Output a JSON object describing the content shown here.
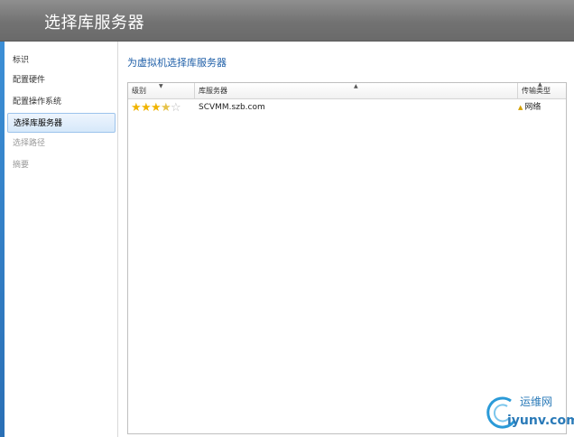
{
  "window": {
    "title": "选择库服务器"
  },
  "sidebar": {
    "items": [
      {
        "label": "标识",
        "state": "normal"
      },
      {
        "label": "配置硬件",
        "state": "normal"
      },
      {
        "label": "配置操作系统",
        "state": "normal"
      },
      {
        "label": "选择库服务器",
        "state": "active"
      },
      {
        "label": "选择路径",
        "state": "disabled"
      },
      {
        "label": "摘要",
        "state": "disabled"
      }
    ]
  },
  "main": {
    "title": "为虚拟机选择库服务器",
    "table": {
      "columns": [
        "级别",
        "库服务器",
        "传输类型"
      ],
      "rows": [
        {
          "rating": 3.5,
          "rating_max": 5,
          "server": "SCVMM.szb.com",
          "transfer": "网络"
        }
      ]
    }
  },
  "watermark": {
    "text1": "运维网",
    "text2": "iyunv.com"
  },
  "colors": {
    "header": "#727272",
    "accent_blue": "#1f5fa8",
    "selected_bg": "#d6e8fa",
    "star": "#f0b400"
  }
}
